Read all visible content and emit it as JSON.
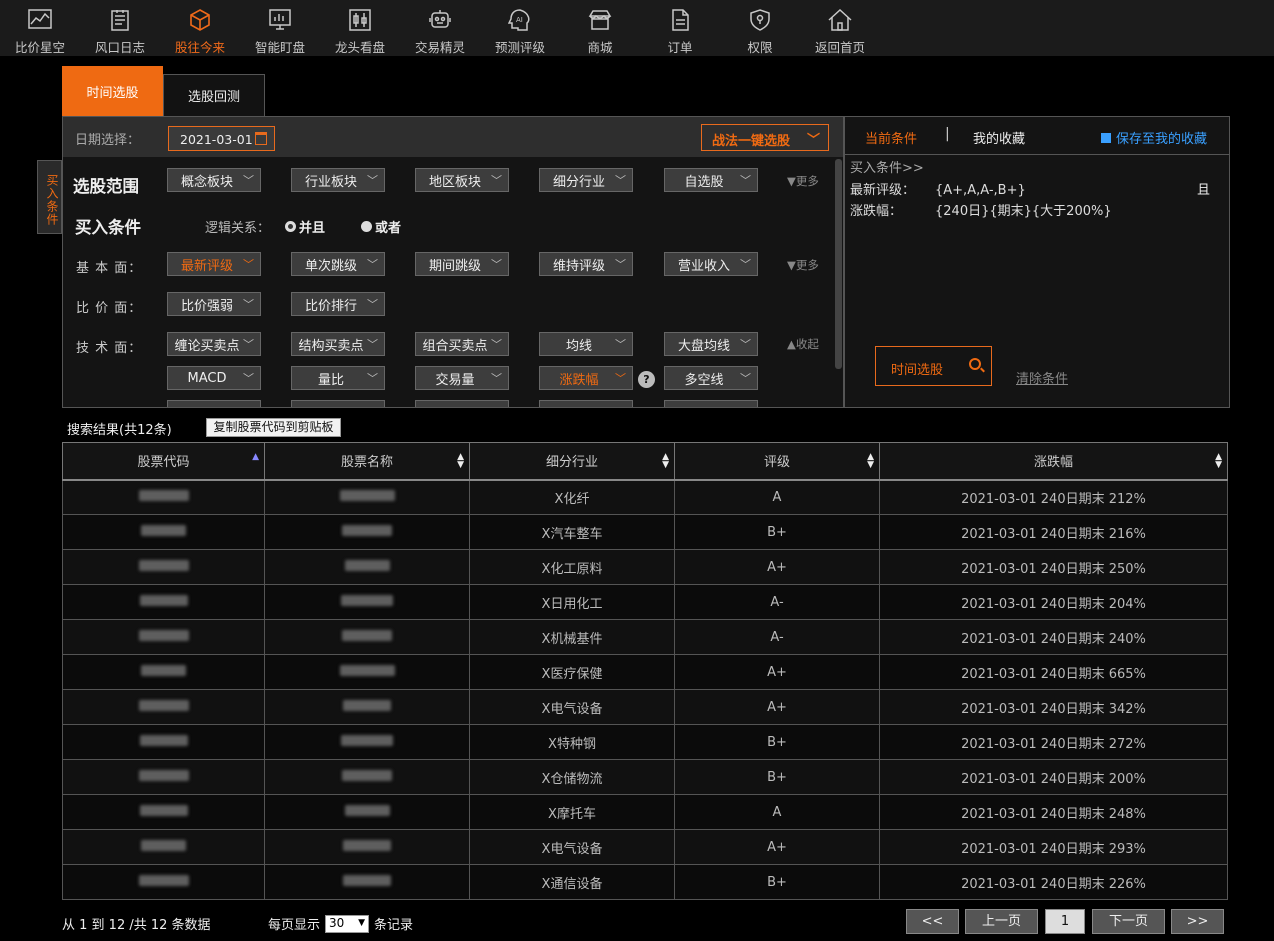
{
  "nav": [
    {
      "label": "比价星空",
      "icon": "chart-line-icon"
    },
    {
      "label": "风口日志",
      "icon": "document-icon"
    },
    {
      "label": "股往今来",
      "icon": "cube-icon",
      "active": true
    },
    {
      "label": "智能盯盘",
      "icon": "monitor-chart-icon"
    },
    {
      "label": "龙头看盘",
      "icon": "candlestick-icon"
    },
    {
      "label": "交易精灵",
      "icon": "robot-icon"
    },
    {
      "label": "预测评级",
      "icon": "ai-icon"
    },
    {
      "label": "商城",
      "icon": "shop-icon"
    },
    {
      "label": "订单",
      "icon": "order-icon"
    },
    {
      "label": "权限",
      "icon": "shield-icon"
    },
    {
      "label": "返回首页",
      "icon": "home-icon"
    }
  ],
  "tabs": {
    "tab1": "时间选股",
    "tab2": "选股回测"
  },
  "side_tag": "买入条件",
  "date": {
    "label": "日期选择：",
    "value": "2021-03-01"
  },
  "strategy_button": "战法一键选股",
  "scope": {
    "title": "选股范围",
    "items": [
      "概念板块",
      "行业板块",
      "地区板块",
      "细分行业",
      "自选股"
    ],
    "more": "更多"
  },
  "buy": {
    "title": "买入条件",
    "logic_label": "逻辑关系：",
    "opt_and": "并且",
    "opt_or": "或者"
  },
  "fundamental": {
    "label": "基 本 面：",
    "items": [
      "最新评级",
      "单次跳级",
      "期间跳级",
      "维持评级",
      "营业收入"
    ],
    "more": "更多"
  },
  "compare": {
    "label": "比 价 面：",
    "items": [
      "比价强弱",
      "比价排行"
    ]
  },
  "technical": {
    "label": "技 术 面：",
    "row1": [
      "缠论买卖点",
      "结构买卖点",
      "组合买卖点",
      "均线",
      "大盘均线"
    ],
    "row2": [
      "MACD",
      "量比",
      "交易量",
      "涨跌幅",
      "多空线"
    ],
    "collapse": "收起"
  },
  "right": {
    "current": "当前条件",
    "sep": "|",
    "favorites": "我的收藏",
    "save": "保存至我的收藏",
    "buy_header": "买入条件>>",
    "cond1_key": "最新评级：",
    "cond1_val": "{A+,A,A-,B+}",
    "cond_and": "且",
    "cond2_key": "涨跌幅：",
    "cond2_val": "{240日}{期末}{大于200%}",
    "search_btn": "时间选股",
    "clear": "清除条件"
  },
  "results": {
    "count": "搜索结果(共12条)",
    "copy": "复制股票代码到剪贴板",
    "headers": [
      "股票代码",
      "股票名称",
      "细分行业",
      "评级",
      "涨跌幅"
    ],
    "rows": [
      {
        "industry": "X化纤",
        "rating": "A",
        "change": "2021-03-01 240日期末 212%"
      },
      {
        "industry": "X汽车整车",
        "rating": "B+",
        "change": "2021-03-01 240日期末 216%"
      },
      {
        "industry": "X化工原料",
        "rating": "A+",
        "change": "2021-03-01 240日期末 250%"
      },
      {
        "industry": "X日用化工",
        "rating": "A-",
        "change": "2021-03-01 240日期末 204%"
      },
      {
        "industry": "X机械基件",
        "rating": "A-",
        "change": "2021-03-01 240日期末 240%"
      },
      {
        "industry": "X医疗保健",
        "rating": "A+",
        "change": "2021-03-01 240日期末 665%"
      },
      {
        "industry": "X电气设备",
        "rating": "A+",
        "change": "2021-03-01 240日期末 342%"
      },
      {
        "industry": "X特种钢",
        "rating": "B+",
        "change": "2021-03-01 240日期末 272%"
      },
      {
        "industry": "X仓储物流",
        "rating": "B+",
        "change": "2021-03-01 240日期末 200%"
      },
      {
        "industry": "X摩托车",
        "rating": "A",
        "change": "2021-03-01 240日期末 248%"
      },
      {
        "industry": "X电气设备",
        "rating": "A+",
        "change": "2021-03-01 240日期末 293%"
      },
      {
        "industry": "X通信设备",
        "rating": "B+",
        "change": "2021-03-01 240日期末 226%"
      }
    ]
  },
  "footer": {
    "info": "从 1 到 12 /共 12 条数据",
    "per_page_pre": "每页显示",
    "per_page_value": "30",
    "per_page_post": "条记录",
    "first": "<<",
    "prev": "上一页",
    "page": "1",
    "next": "下一页",
    "last": ">>"
  },
  "colors": {
    "accent": "#ef6a12",
    "link": "#3aa0ff",
    "bg": "#000000"
  }
}
